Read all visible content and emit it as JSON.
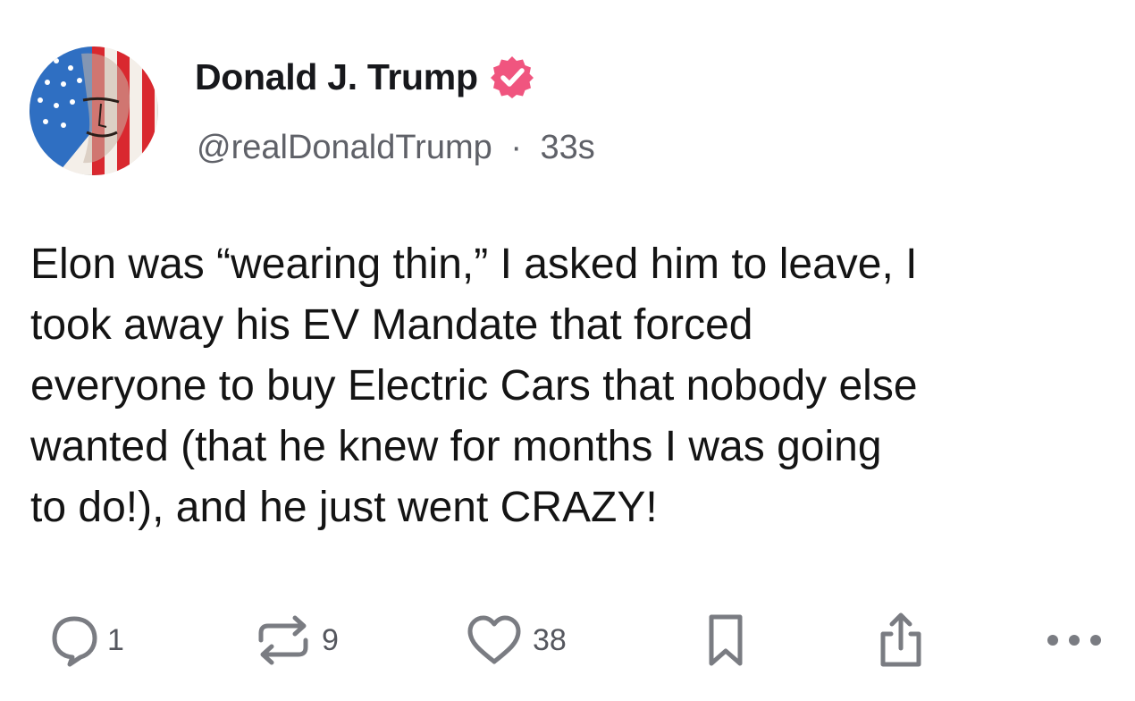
{
  "post": {
    "author": {
      "display_name": "Donald J. Trump",
      "handle": "@realDonaldTrump",
      "separator": "·",
      "time": "33s",
      "verified": true,
      "verified_color": "#f0557f",
      "avatar_icon": "flag-portrait-avatar"
    },
    "text_lines": [
      "Elon was “wearing thin,” I asked him to leave, I",
      "took away his EV Mandate that forced",
      "everyone to buy Electric Cars that nobody else",
      "wanted (that he knew for months I was going",
      "to do!), and he just went CRAZY!"
    ],
    "actions": {
      "reply_count": "1",
      "repost_count": "9",
      "like_count": "38",
      "icons": [
        "reply-icon",
        "repost-icon",
        "like-icon",
        "bookmark-icon",
        "share-icon",
        "more-icon"
      ]
    }
  },
  "colors": {
    "text": "#141414",
    "muted": "#5f6168",
    "icon": "#7a7c82",
    "accent": "#f0557f"
  }
}
